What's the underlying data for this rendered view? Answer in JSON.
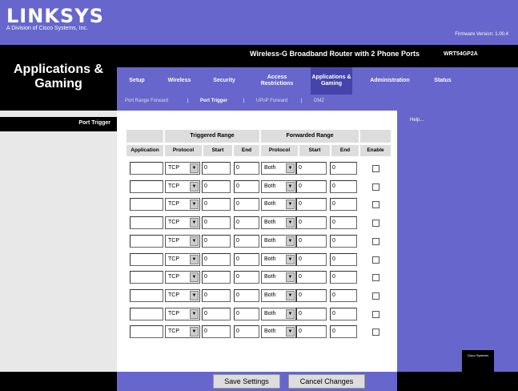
{
  "header": {
    "brand": "LINKSYS",
    "division": "A Division of Cisco Systems, Inc.",
    "firmware": "Firmware Version: 1.00.4",
    "product": "Wireless-G Broadband Router with 2 Phone Ports",
    "model": "WRT54GP2A"
  },
  "section_title": "Applications & Gaming",
  "tabs": [
    {
      "label": "Setup"
    },
    {
      "label": "Wireless"
    },
    {
      "label": "Security"
    },
    {
      "label": "Access Restrictions"
    },
    {
      "label": "Applications & Gaming"
    },
    {
      "label": "Administration"
    },
    {
      "label": "Status"
    }
  ],
  "subtabs": {
    "port_range_forward": "Port Range Forward",
    "port_trigger": "Port Trigger",
    "upnp_forward": "UPnP Forward",
    "dmz": "DMZ",
    "separator": "|"
  },
  "left_heading": "Port Trigger",
  "help_link": "Help...",
  "cisco_logo": "Cisco Systems",
  "table": {
    "group_triggered": "Triggered Range",
    "group_forwarded": "Forwarded Range",
    "columns": {
      "application": "Application",
      "trig_protocol": "Protocol",
      "trig_start": "Start",
      "trig_end": "End",
      "fwd_protocol": "Protocol",
      "fwd_start": "Start",
      "fwd_end": "End",
      "enable": "Enable"
    },
    "rows": [
      {
        "application": "",
        "trig_protocol": "TCP",
        "trig_start": "0",
        "trig_end": "0",
        "fwd_protocol": "Both",
        "fwd_start": "0",
        "fwd_end": "0",
        "enabled": false
      },
      {
        "application": "",
        "trig_protocol": "TCP",
        "trig_start": "0",
        "trig_end": "0",
        "fwd_protocol": "Both",
        "fwd_start": "0",
        "fwd_end": "0",
        "enabled": false
      },
      {
        "application": "",
        "trig_protocol": "TCP",
        "trig_start": "0",
        "trig_end": "0",
        "fwd_protocol": "Both",
        "fwd_start": "0",
        "fwd_end": "0",
        "enabled": false
      },
      {
        "application": "",
        "trig_protocol": "TCP",
        "trig_start": "0",
        "trig_end": "0",
        "fwd_protocol": "Both",
        "fwd_start": "0",
        "fwd_end": "0",
        "enabled": false
      },
      {
        "application": "",
        "trig_protocol": "TCP",
        "trig_start": "0",
        "trig_end": "0",
        "fwd_protocol": "Both",
        "fwd_start": "0",
        "fwd_end": "0",
        "enabled": false
      },
      {
        "application": "",
        "trig_protocol": "TCP",
        "trig_start": "0",
        "trig_end": "0",
        "fwd_protocol": "Both",
        "fwd_start": "0",
        "fwd_end": "0",
        "enabled": false
      },
      {
        "application": "",
        "trig_protocol": "TCP",
        "trig_start": "0",
        "trig_end": "0",
        "fwd_protocol": "Both",
        "fwd_start": "0",
        "fwd_end": "0",
        "enabled": false
      },
      {
        "application": "",
        "trig_protocol": "TCP",
        "trig_start": "0",
        "trig_end": "0",
        "fwd_protocol": "Both",
        "fwd_start": "0",
        "fwd_end": "0",
        "enabled": false
      },
      {
        "application": "",
        "trig_protocol": "TCP",
        "trig_start": "0",
        "trig_end": "0",
        "fwd_protocol": "Both",
        "fwd_start": "0",
        "fwd_end": "0",
        "enabled": false
      },
      {
        "application": "",
        "trig_protocol": "TCP",
        "trig_start": "0",
        "trig_end": "0",
        "fwd_protocol": "Both",
        "fwd_start": "0",
        "fwd_end": "0",
        "enabled": false
      }
    ]
  },
  "buttons": {
    "save": "Save Settings",
    "cancel": "Cancel Changes"
  },
  "colors": {
    "accent": "#6666cc",
    "active_tab": "#4444aa"
  }
}
